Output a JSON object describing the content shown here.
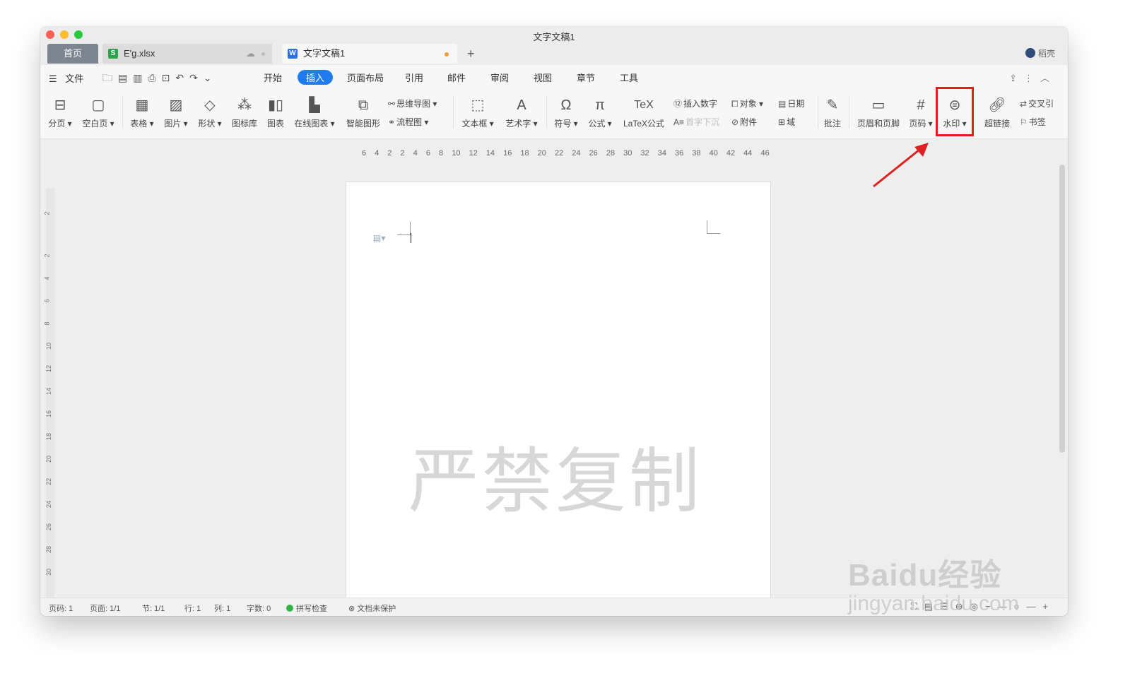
{
  "window": {
    "title": "文字文稿1"
  },
  "tabs": {
    "home": "首页",
    "xlsx": "E'g.xlsx",
    "doc": "文字文稿1",
    "new": "+",
    "account": "稻壳"
  },
  "menu": {
    "file": "文件",
    "items": [
      "开始",
      "插入",
      "页面布局",
      "引用",
      "邮件",
      "审阅",
      "视图",
      "章节",
      "工具"
    ],
    "active": "插入"
  },
  "ribbon": {
    "page_break": "分页",
    "blank_page": "空白页",
    "table": "表格",
    "picture": "图片",
    "shape": "形状",
    "icon_lib": "图标库",
    "chart": "图表",
    "online_chart": "在线图表",
    "smart_art": "智能图形",
    "mind_map": "思维导图",
    "flowchart": "流程图",
    "text_box": "文本框",
    "word_art": "艺术字",
    "symbol": "符号",
    "formula": "公式",
    "latex": "LaTeX公式",
    "insert_number": "插入数字",
    "drop_cap": "首字下沉",
    "object": "对象",
    "attachment": "附件",
    "date": "日期",
    "field": "域",
    "comment": "批注",
    "header_footer": "页眉和页脚",
    "page_number": "页码",
    "watermark": "水印",
    "hyperlink": "超链接",
    "cross_ref": "交叉引",
    "bookmark": "书签"
  },
  "ruler": {
    "horizontal": "6 4 2 2 4 6 8 10 12 14 16 18 20 22 24 26 28 30 32 34 36 38 40 42 44 46"
  },
  "document": {
    "watermark_text": "严禁复制"
  },
  "status": {
    "page_code": "页码: 1",
    "pages": "页面: 1/1",
    "section": "节: 1/1",
    "row": "行: 1",
    "col": "列: 1",
    "words": "字数: 0",
    "spell_check": "拼写检查",
    "protection": "文档未保护"
  },
  "overlay": {
    "baidu_logo": "Baidu经验",
    "baidu_url": "jingyan.baidu.com"
  }
}
